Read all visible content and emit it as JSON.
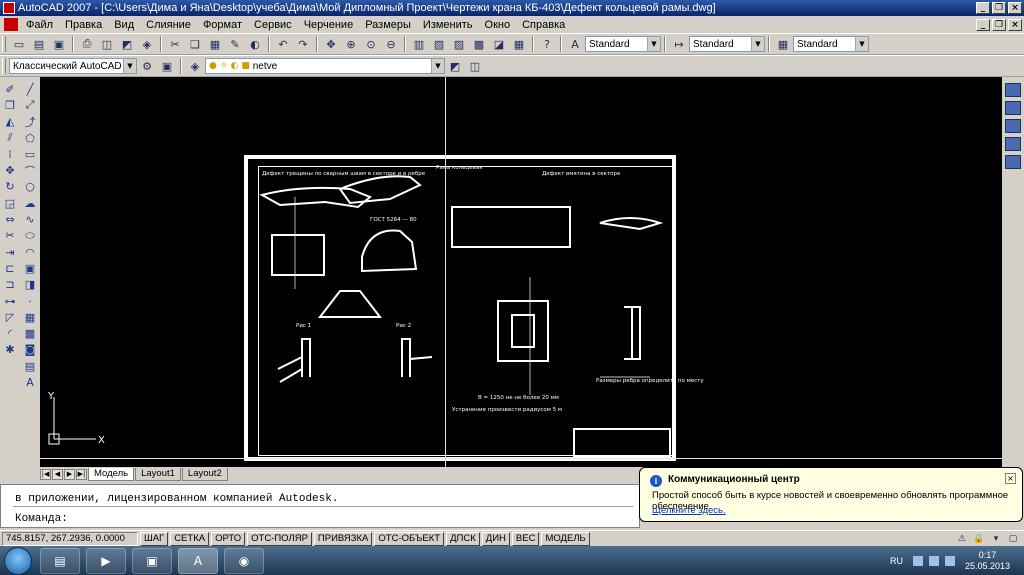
{
  "window": {
    "title": "AutoCAD 2007 - [C:\\Users\\Дима и Яна\\Desktop\\учеба\\Дима\\Мой Дипломный Проект\\Чертежи крана КБ-403\\Дефект кольцевой рамы.dwg]"
  },
  "menu": [
    "Файл",
    "Правка",
    "Вид",
    "Слияние",
    "Формат",
    "Сервис",
    "Черчение",
    "Размеры",
    "Изменить",
    "Окно",
    "Справка"
  ],
  "styles_toolbar": {
    "text_style": "Standard",
    "dim_style": "Standard",
    "table_style": "Standard"
  },
  "workspace_toolbar": {
    "workspace": "Классический AutoCAD",
    "layer": "netve"
  },
  "drawing": {
    "labels": [
      "Рама кольцевая",
      "Дефект трещины по сварным швам в секторе и в ребре",
      "Дефект вмятина в секторе",
      "ГОСТ 5264 — 80",
      "Рис 1",
      "Рис 2",
      "В = 1250 не не более 20 мм",
      "Устранение произвести радиусом 5 м",
      "Размеры ребра определить по месту"
    ]
  },
  "tabs": [
    "Модель",
    "Layout1",
    "Layout2"
  ],
  "active_tab": "Модель",
  "command": {
    "history": "в приложении, лицензированном компанией Autodesk.",
    "prompt": "Команда:"
  },
  "status": {
    "coords": "745.8157, 267.2936, 0.0000",
    "buttons": [
      "ШАГ",
      "СЕТКА",
      "ОРТО",
      "ОТС-ПОЛЯР",
      "ПРИВЯЗКА",
      "ОТС-ОБЪЕКТ",
      "ДПСК",
      "ДИН",
      "ВЕС",
      "МОДЕЛЬ"
    ]
  },
  "balloon": {
    "title": "Коммуникационный центр",
    "body": "Простой способ быть в курсе новостей и своевременно обновлять программное обеспечение.",
    "link": "Щелкните здесь."
  },
  "taskbar": {
    "lang": "RU",
    "time": "0:17",
    "date": "25.05.2013"
  },
  "colors": {
    "canvas": "#000000",
    "title_bar": "#0a246a",
    "balloon_bg": "#ffffe1"
  }
}
